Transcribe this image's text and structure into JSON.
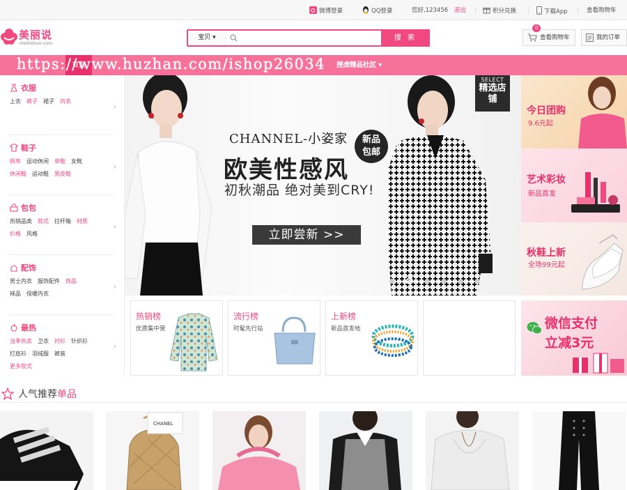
{
  "topbar": {
    "weibo_login": "微博登录",
    "qq_login": "QQ登录",
    "greeting": "您好,123456",
    "logout": "退出",
    "points": "积分兑换",
    "download_app": "下载App",
    "view_cart": "查看购物车"
  },
  "logo": {
    "name": "美丽说",
    "domain": "meilishuo.com"
  },
  "search": {
    "category": "宝贝 ▾",
    "placeholder": "",
    "button": "搜 索"
  },
  "header": {
    "cart_count": "0",
    "cart_label": "查看购物车",
    "orders_label": "我的订单"
  },
  "nav": {
    "home": "首页",
    "watermark": "https://www.huzhan.com/ishop26034",
    "tail": "授虑精品社区 ▾"
  },
  "sidebar": [
    {
      "title": "衣服",
      "icon": "dress-icon",
      "rows": [
        [
          {
            "t": "上衣",
            "pink": false
          },
          {
            "t": "裤子",
            "pink": true
          },
          {
            "t": "裙子",
            "pink": false
          },
          {
            "t": "内衣",
            "pink": true
          }
        ]
      ]
    },
    {
      "title": "鞋子",
      "icon": "shirt-icon",
      "rows": [
        [
          {
            "t": "帆布",
            "pink": true
          },
          {
            "t": "运动休闲",
            "pink": false
          },
          {
            "t": "单鞋",
            "pink": true
          },
          {
            "t": "女靴",
            "pink": false
          }
        ],
        [
          {
            "t": "休闲鞋",
            "pink": true
          },
          {
            "t": "运动鞋",
            "pink": false
          },
          {
            "t": "男皮鞋",
            "pink": true
          }
        ]
      ]
    },
    {
      "title": "包包",
      "icon": "bag-icon",
      "rows": [
        [
          {
            "t": "热销品类",
            "pink": false
          },
          {
            "t": "款式",
            "pink": true
          },
          {
            "t": "拉杆箱",
            "pink": false
          },
          {
            "t": "材质",
            "pink": true
          }
        ],
        [
          {
            "t": "价格",
            "pink": true
          },
          {
            "t": "风格",
            "pink": false
          }
        ]
      ]
    },
    {
      "title": "配饰",
      "icon": "accessory-icon",
      "rows": [
        [
          {
            "t": "男士内衣",
            "pink": false
          },
          {
            "t": "服饰配件",
            "pink": false
          },
          {
            "t": "饰品",
            "pink": true
          }
        ],
        [
          {
            "t": "袜品",
            "pink": false
          },
          {
            "t": "保暖内衣",
            "pink": false
          }
        ]
      ]
    },
    {
      "title": "最热",
      "icon": "hot-icon",
      "rows": [
        [
          {
            "t": "当季热卖",
            "pink": true
          },
          {
            "t": "卫衣",
            "pink": false
          },
          {
            "t": "衬衫",
            "pink": true
          },
          {
            "t": "针织衫",
            "pink": false
          }
        ],
        [
          {
            "t": "打底衫",
            "pink": false
          },
          {
            "t": "羽绒服",
            "pink": false
          },
          {
            "t": "裤装",
            "pink": false
          }
        ],
        [
          {
            "t": "更多款式",
            "pink": true
          }
        ]
      ]
    }
  ],
  "banner": {
    "brand": "CHANNEL-小姿家",
    "headline": "欧美性感风",
    "subline": "初秋潮品 绝对美到CRY!",
    "stamp": "新品包邮",
    "cta": "立即尝新 >>",
    "select_en": "SELECT",
    "select_cn": "精选店铺",
    "slide_count": 6,
    "active_slide": 2
  },
  "promos": [
    {
      "title": "今日团购",
      "sub": "9.6元起"
    },
    {
      "title": "艺术彩妆",
      "sub": "新品首发"
    },
    {
      "title": "秋鞋上新",
      "sub": "全场99元起"
    }
  ],
  "tiles": [
    {
      "title": "热销榜",
      "sub": "优质集中营"
    },
    {
      "title": "流行榜",
      "sub": "时髦先行站"
    },
    {
      "title": "上新榜",
      "sub": "新品首发地"
    },
    {
      "title": "",
      "sub": ""
    }
  ],
  "wechat": {
    "line1": "微信支付",
    "line2": "立减3元"
  },
  "recommend": {
    "title_a": "人气推荐",
    "title_b": "单品"
  },
  "colors": {
    "brand_pink": "#f0487f",
    "nav_pink": "#f7729b",
    "nav_active": "#e8306c"
  }
}
